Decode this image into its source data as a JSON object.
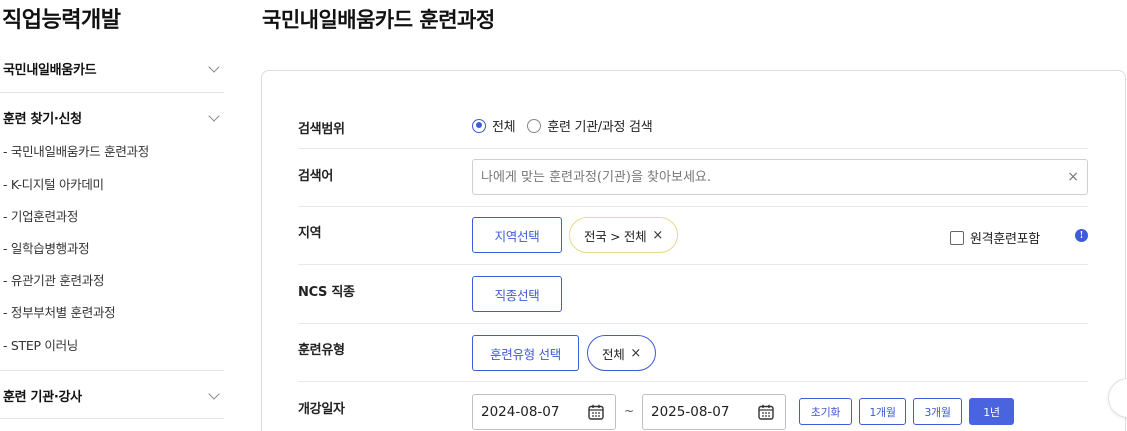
{
  "sidebar": {
    "title": "직업능력개발",
    "sections": [
      {
        "label": "국민내일배움카드"
      },
      {
        "label": "훈련 찾기·신청"
      },
      {
        "label": "훈련 기관·강사"
      }
    ],
    "sub_items": [
      "- 국민내일배움카드 훈련과정",
      "- K-디지털 아카데미",
      "- 기업훈련과정",
      "- 일학습병행과정",
      "- 유관기관 훈련과정",
      "- 정부부처별 훈련과정",
      "- STEP 이러닝"
    ]
  },
  "main": {
    "title": "국민내일배움카드 훈련과정",
    "search_scope": {
      "label": "검색범위",
      "options": [
        "전체",
        "훈련 기관/과정 검색"
      ],
      "selected": "전체"
    },
    "keyword": {
      "label": "검색어",
      "value": "",
      "placeholder": "나에게 맞는 훈련과정(기관)을 찾아보세요.",
      "clear": "×"
    },
    "region": {
      "label": "지역",
      "button": "지역선택",
      "chip": "전국 > 전체",
      "chip_remove": "×",
      "remote_checkbox": "원격훈련포함",
      "remote_checked": false,
      "info": "!"
    },
    "ncs": {
      "label": "NCS 직종",
      "button": "직종선택"
    },
    "training_type": {
      "label": "훈련유형",
      "button": "훈련유형 선택",
      "chip": "전체",
      "chip_remove": "×"
    },
    "start_date": {
      "label": "개강일자",
      "from": "2024-08-07",
      "separator": "~",
      "to": "2025-08-07",
      "periods": [
        "초기화",
        "1개월",
        "3개월",
        "1년"
      ],
      "active_period": "1년"
    }
  },
  "colors": {
    "accent": "#3f5bd5",
    "active_fill": "#4a63df",
    "chip_region_border": "#e9d98a",
    "chip_type_border": "#3f5bd5"
  }
}
